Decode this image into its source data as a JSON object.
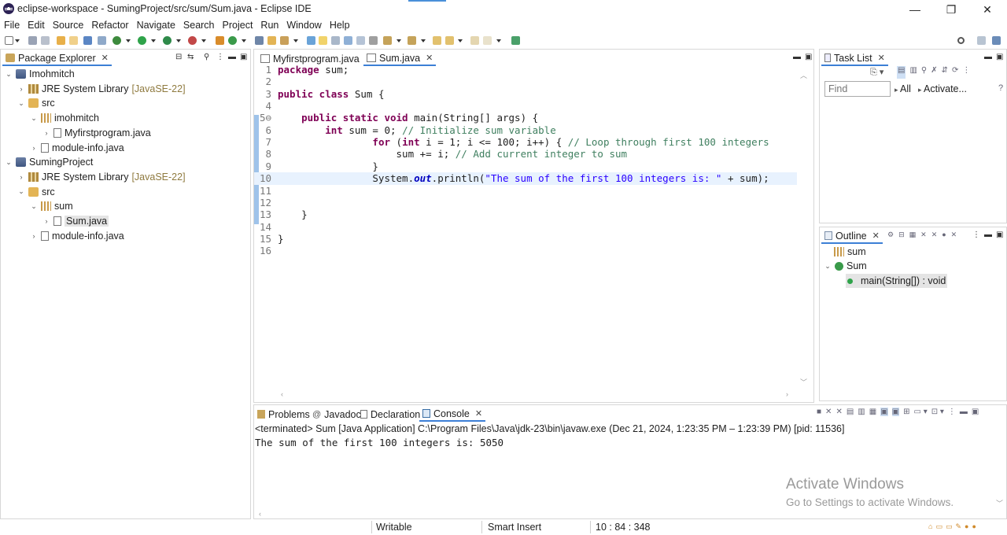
{
  "window": {
    "title": "eclipse-workspace - SumingProject/src/sum/Sum.java - Eclipse IDE",
    "minimize": "—",
    "restore": "❐",
    "close": "✕"
  },
  "menu": [
    "File",
    "Edit",
    "Source",
    "Refactor",
    "Navigate",
    "Search",
    "Project",
    "Run",
    "Window",
    "Help"
  ],
  "package_explorer": {
    "title": "Package Explorer",
    "tree": [
      {
        "label": "Imohmitch",
        "extra": "",
        "level": 0,
        "chev": "⌄",
        "icon": "project-icon"
      },
      {
        "label": "JRE System Library",
        "extra": "[JavaSE-22]",
        "level": 1,
        "chev": "›",
        "icon": "library-icon"
      },
      {
        "label": "src",
        "extra": "",
        "level": 1,
        "chev": "⌄",
        "icon": "source-folder-icon"
      },
      {
        "label": "imohmitch",
        "extra": "",
        "level": 2,
        "chev": "⌄",
        "icon": "package-icon"
      },
      {
        "label": "Myfirstprogram.java",
        "extra": "",
        "level": 3,
        "chev": "›",
        "icon": "java-file-icon"
      },
      {
        "label": "module-info.java",
        "extra": "",
        "level": 2,
        "chev": "›",
        "icon": "java-file-icon"
      },
      {
        "label": "SumingProject",
        "extra": "",
        "level": 0,
        "chev": "⌄",
        "icon": "project-icon"
      },
      {
        "label": "JRE System Library",
        "extra": "[JavaSE-22]",
        "level": 1,
        "chev": "›",
        "icon": "library-icon"
      },
      {
        "label": "src",
        "extra": "",
        "level": 1,
        "chev": "⌄",
        "icon": "source-folder-icon"
      },
      {
        "label": "sum",
        "extra": "",
        "level": 2,
        "chev": "⌄",
        "icon": "package-icon"
      },
      {
        "label": "Sum.java",
        "extra": "",
        "level": 3,
        "chev": "›",
        "icon": "java-file-icon",
        "selected": true
      },
      {
        "label": "module-info.java",
        "extra": "",
        "level": 2,
        "chev": "›",
        "icon": "java-file-icon"
      }
    ]
  },
  "editor": {
    "tabs": [
      {
        "label": "Myfirstprogram.java",
        "active": false
      },
      {
        "label": "Sum.java",
        "active": true
      }
    ],
    "lines": [
      {
        "n": "1",
        "html": "<span class=\"kw\">package</span> sum;"
      },
      {
        "n": "2",
        "html": ""
      },
      {
        "n": "3",
        "html": "<span class=\"kw\">public class</span> Sum {"
      },
      {
        "n": "4",
        "html": ""
      },
      {
        "n": "5⊖",
        "html": "    <span class=\"kw\">public static void</span> main(String[] args) {"
      },
      {
        "n": "6",
        "html": "        <span class=\"kw\">int</span> sum = 0; <span class=\"cm\">// Initialize sum variable</span>"
      },
      {
        "n": "7",
        "html": "                <span class=\"kw\">for</span> (<span class=\"kw\">int</span> i = 1; i &lt;= 100; i++) { <span class=\"cm\">// Loop through first 100 integers</span>"
      },
      {
        "n": "8",
        "html": "                    sum += i; <span class=\"cm\">// Add current integer to sum</span>"
      },
      {
        "n": "9",
        "html": "                }"
      },
      {
        "n": "10",
        "html": "                System.<span class=\"fld\">out</span>.println(<span class=\"str\">\"The sum of the first 100 integers is: \"</span> + sum);",
        "current": true
      },
      {
        "n": "11",
        "html": ""
      },
      {
        "n": "12",
        "html": ""
      },
      {
        "n": "13",
        "html": "    }"
      },
      {
        "n": "14",
        "html": ""
      },
      {
        "n": "15",
        "html": "}"
      },
      {
        "n": "16",
        "html": ""
      }
    ]
  },
  "task_list": {
    "title": "Task List",
    "find_placeholder": "Find",
    "all_label": "All",
    "activate_label": "Activate..."
  },
  "outline": {
    "title": "Outline",
    "items": [
      {
        "label": "sum",
        "icon": "package-icon"
      },
      {
        "label": "Sum",
        "icon": "class-icon"
      },
      {
        "label": "main(String[]) : void",
        "icon": "method-icon"
      }
    ]
  },
  "console": {
    "tabs": [
      "Problems",
      "Javadoc",
      "Declaration",
      "Console"
    ],
    "active_tab": "Console",
    "status_line": "<terminated> Sum [Java Application] C:\\Program Files\\Java\\jdk-23\\bin\\javaw.exe  (Dec 21, 2024, 1:23:35 PM – 1:23:39 PM) [pid: 11536]",
    "output": "The sum of the first 100 integers is: 5050"
  },
  "watermark": {
    "title": "Activate Windows",
    "subtitle": "Go to Settings to activate Windows."
  },
  "status": {
    "writable": "Writable",
    "insert_mode": "Smart Insert",
    "position": "10 : 84 : 348"
  },
  "colors": {
    "accent": "#3c7fd6",
    "keyword": "#7f0055",
    "comment": "#3f7f5f",
    "string": "#2a00ff"
  }
}
